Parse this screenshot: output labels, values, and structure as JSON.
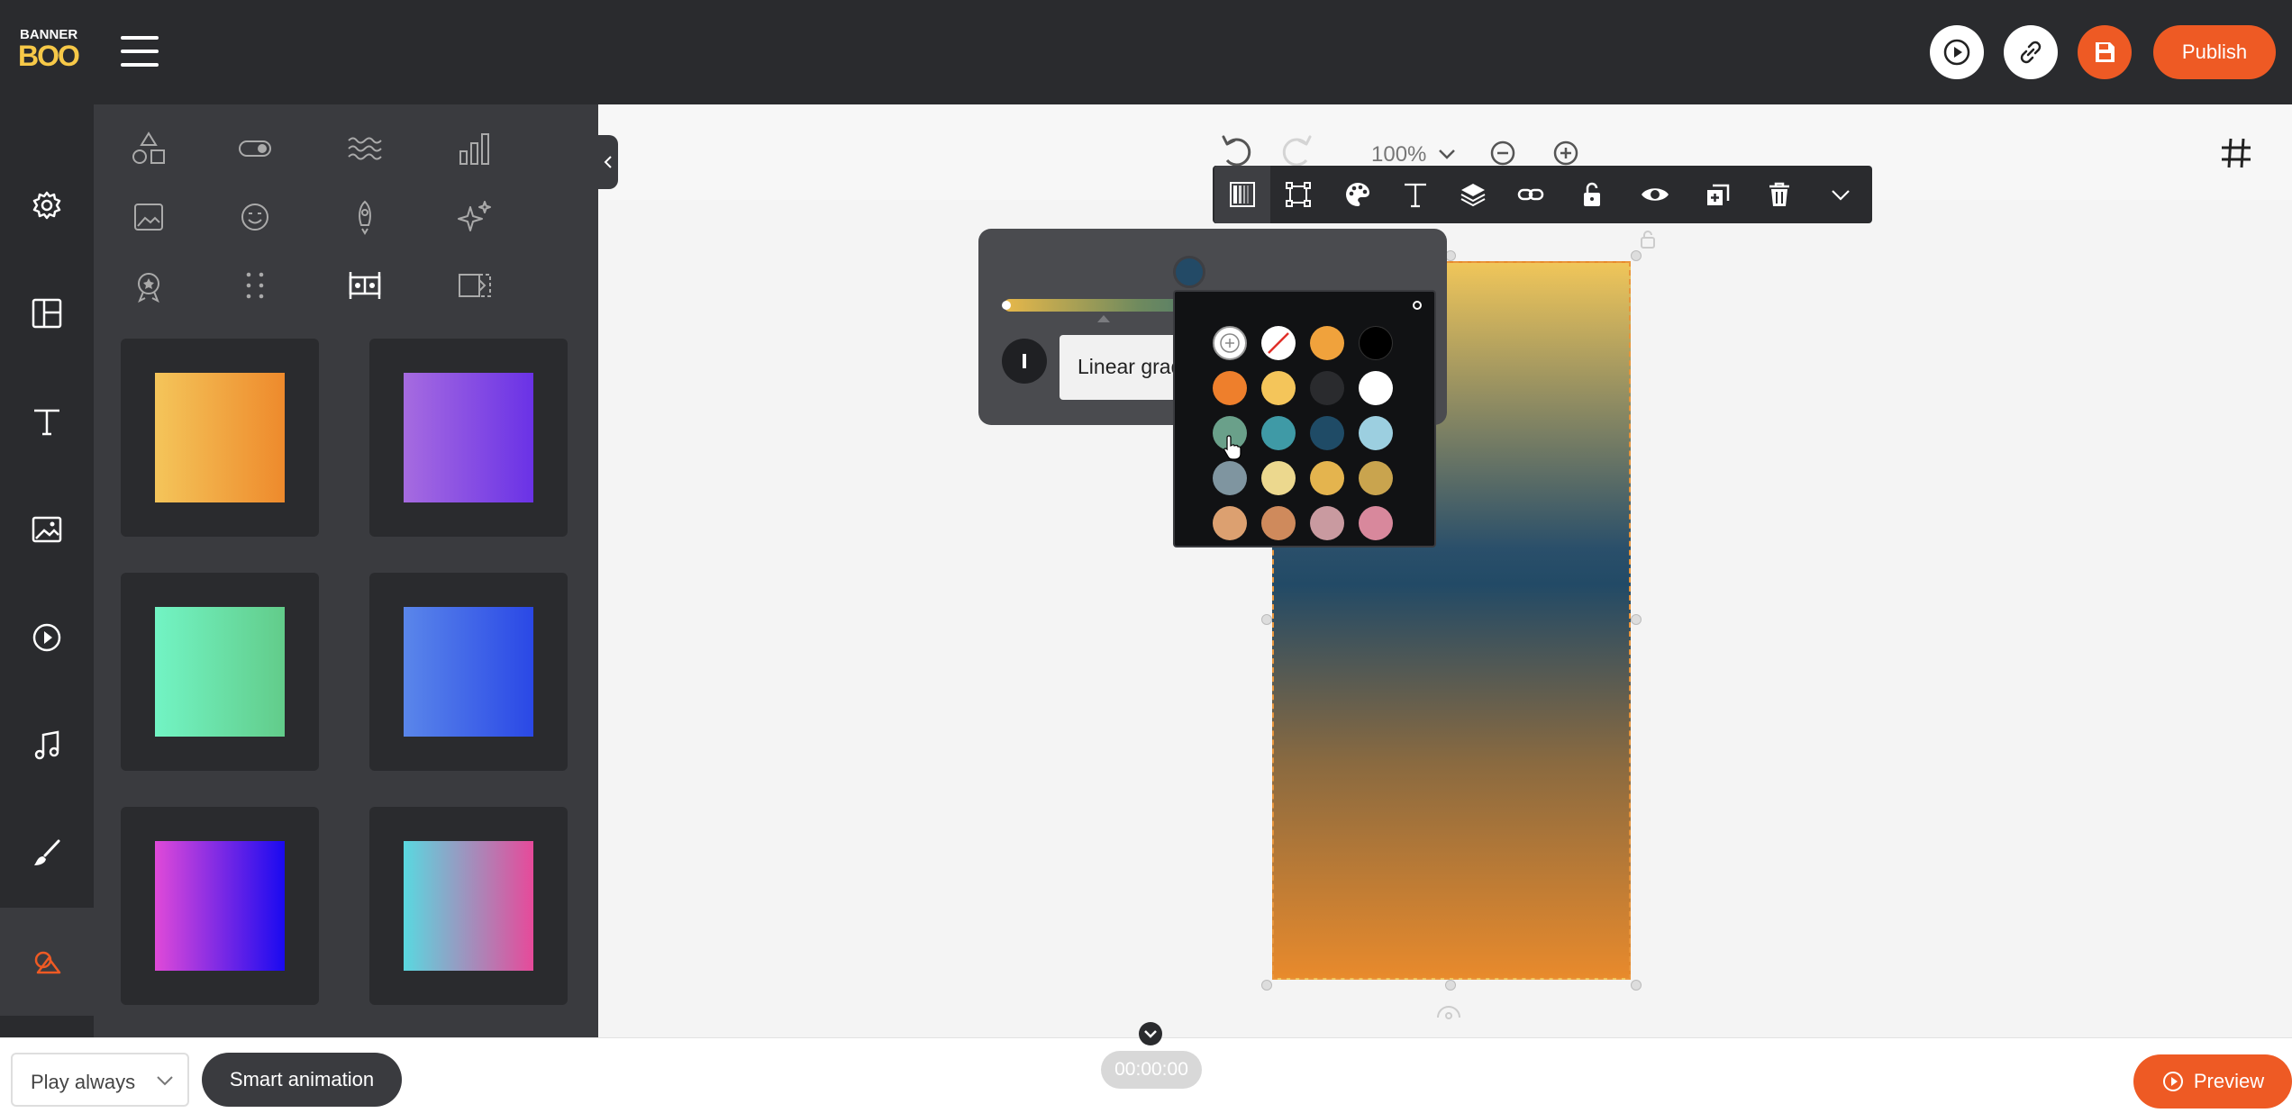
{
  "brand": {
    "logo_top": "BANNER",
    "logo_bottom": "BOO"
  },
  "topbar": {
    "publish_label": "Publish"
  },
  "canvas": {
    "zoom": "100%"
  },
  "gradient": {
    "type_label": "Linear gradient"
  },
  "palette": {
    "colors": [
      "add",
      "none",
      "#f0a23c",
      "#000000",
      "#ee7f2c",
      "#f4c55a",
      "#2a2b2e",
      "#ffffff",
      "#6aa08a",
      "#3f9aa6",
      "#1f4b66",
      "#9ccfe0",
      "#7f95a0",
      "#ecd88e",
      "#e4b44e",
      "#c9a44e",
      "#dca070",
      "#cf8a5c",
      "#c99aa0",
      "#d8889c"
    ]
  },
  "gradients": [
    {
      "from": "#f4c55a",
      "to": "#ee8a2c",
      "dir": "90deg"
    },
    {
      "from": "#a66be0",
      "to": "#6a32e6",
      "dir": "90deg"
    },
    {
      "from": "#72f4c4",
      "to": "#62cc8a",
      "dir": "90deg"
    },
    {
      "from": "#5a86ea",
      "to": "#2a48e6",
      "dir": "90deg"
    },
    {
      "from": "#e04ad8",
      "to": "#1a0af0",
      "dir": "90deg"
    },
    {
      "from": "#5ad8e0",
      "to": "#e64a9a",
      "dir": "90deg"
    }
  ],
  "bottombar": {
    "play_option": "Play always",
    "smart_animation_label": "Smart animation",
    "timecode": "00:00:00",
    "preview_label": "Preview"
  }
}
